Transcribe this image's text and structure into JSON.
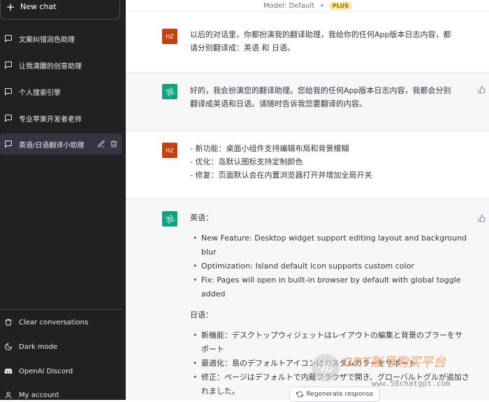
{
  "sidebar": {
    "new_chat_label": "New chat",
    "conversations": [
      {
        "label": "文案纠错润色助理"
      },
      {
        "label": "让我清醒的创意助理"
      },
      {
        "label": "个人搜索引擎"
      },
      {
        "label": "专业苹果开发者老师"
      },
      {
        "label": "英语/日语翻译小助理",
        "active": true
      }
    ],
    "bottom_items": [
      {
        "label": "Clear conversations",
        "icon": "trash-icon"
      },
      {
        "label": "Dark mode",
        "icon": "moon-icon"
      },
      {
        "label": "OpenAI Discord",
        "icon": "discord-icon"
      },
      {
        "label": "My account",
        "icon": "user-icon"
      }
    ]
  },
  "header": {
    "model_label": "Model: Default",
    "dot": "•",
    "plan_badge": "PLUS"
  },
  "messages": [
    {
      "role": "user",
      "avatar": "HZ",
      "lines": [
        "以后的对话里，你都扮演我的翻译助理，我给你的任何App版本日志内容，都",
        "请分别翻译成：英语 和 日语。"
      ]
    },
    {
      "role": "assistant",
      "lines": [
        "好的，我会扮演您的翻译助理。您给我的任何App版本日志内容，我都会分别",
        "翻译成英语和日语。请随时告诉我您要翻译的内容。"
      ]
    },
    {
      "role": "user",
      "avatar": "HZ",
      "lines": [
        "- 新功能：桌面小组件支持编辑布局和背景模糊",
        "- 优化：岛默认图标支持定制颜色",
        "- 修复：页面默认会在内置浏览器打开并增加全局开关"
      ]
    },
    {
      "role": "assistant",
      "english_heading": "英语：",
      "english_items": [
        "New Feature: Desktop widget support editing layout and background blur",
        "Optimization: Island default icon supports custom color",
        "Fix: Pages will open in built-in browser by default with global toggle added"
      ],
      "japanese_heading": "日语：",
      "japanese_items": [
        "新機能：デスクトップウィジェットはレイアウトの編集と背景のブラーをサポート",
        "最適化：島のデフォルトアイコンはカスタムカラーをサポート",
        "修正：ページはデフォルトで内蔵ブラウザで開き、グローバルトグルが追加されました。"
      ]
    }
  ],
  "regenerate_label": "Regenerate response",
  "watermark": {
    "title": "GPT账号购买平台",
    "url": "www.58chatgpt.com"
  },
  "colors": {
    "sidebar_bg": "#202123",
    "active_item_bg": "#343541",
    "assistant_bg": "#f7f7f8",
    "user_avatar": "#c4420e",
    "gpt_avatar": "#10a37f",
    "plus_badge": "#fae69e"
  }
}
